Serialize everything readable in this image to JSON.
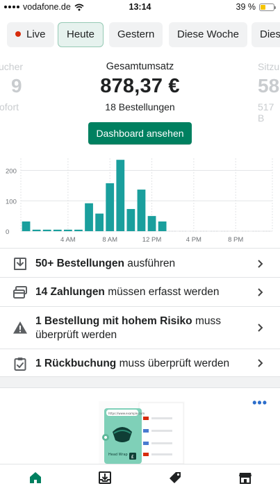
{
  "status_bar": {
    "carrier": "vodafone.de",
    "time": "13:14",
    "battery": "39 %"
  },
  "filters": [
    {
      "label": "Live",
      "active": false
    },
    {
      "label": "Heute",
      "active": true
    },
    {
      "label": "Gestern",
      "active": false
    },
    {
      "label": "Diese Woche",
      "active": false
    },
    {
      "label": "Dies",
      "active": false
    }
  ],
  "metrics": {
    "left": {
      "title": "ucher",
      "value": "9",
      "sub": "ofort"
    },
    "center": {
      "title": "Gesamtumsatz",
      "value": "878,37 €",
      "sub": "18 Bestellungen"
    },
    "right": {
      "title": "Sitzu",
      "value": "58",
      "sub": "517 B"
    }
  },
  "dashboard_button": "Dashboard ansehen",
  "chart_data": {
    "type": "bar",
    "categories": [
      "0",
      "1",
      "2",
      "3",
      "4",
      "5",
      "6",
      "7",
      "8",
      "9",
      "10",
      "11",
      "12",
      "13",
      "14",
      "15",
      "16",
      "17",
      "18",
      "19",
      "20",
      "21",
      "22",
      "23"
    ],
    "values": [
      32,
      5,
      5,
      5,
      5,
      5,
      92,
      58,
      158,
      235,
      73,
      137,
      50,
      32,
      0,
      0,
      0,
      0,
      0,
      0,
      0,
      0,
      0,
      0
    ],
    "x_tick_labels": [
      "4 AM",
      "8 AM",
      "12 PM",
      "4 PM",
      "8 PM"
    ],
    "y_tick_labels": [
      "200",
      "100",
      "0"
    ],
    "ylim": [
      0,
      240
    ],
    "bar_color": "#1a9f9d",
    "grid": true
  },
  "tasks": [
    {
      "bold": "50+ Bestellungen",
      "rest": " ausführen",
      "icon": "download-box-icon"
    },
    {
      "bold": "14 Zahlungen",
      "rest": " müssen erfasst werden",
      "icon": "card-stack-icon"
    },
    {
      "bold": "1 Bestellung mit hohem Risiko",
      "rest": " muss überprüft werden",
      "icon": "warning-triangle-icon"
    },
    {
      "bold": "1 Rückbuchung",
      "rest": " muss überprüft werden",
      "icon": "clipboard-check-icon"
    }
  ],
  "more_menu": "•••",
  "illustration": {
    "url_text": "https://www.example.com",
    "product_text": "Head Wrap"
  },
  "bottom_nav": [
    {
      "icon": "home-icon",
      "active": true
    },
    {
      "icon": "orders-icon",
      "active": false
    },
    {
      "icon": "tag-icon",
      "active": false
    },
    {
      "icon": "store-icon",
      "active": false
    }
  ],
  "colors": {
    "primary": "#008060",
    "chart": "#1a9f9d",
    "live": "#d72c0d"
  }
}
